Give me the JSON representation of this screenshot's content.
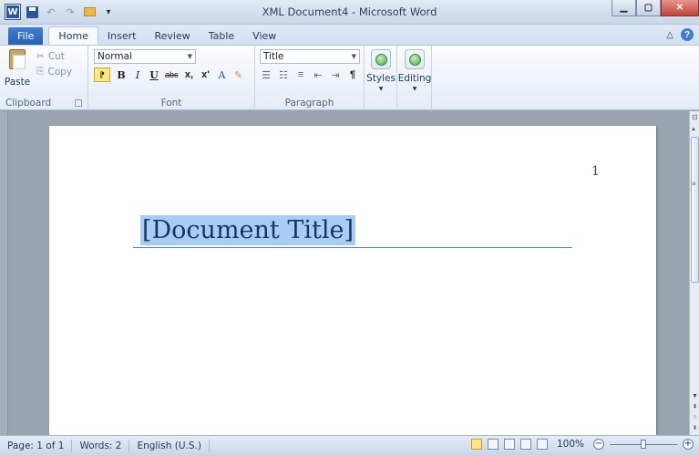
{
  "window": {
    "title": "XML Document4 - Microsoft Word",
    "logo_text": "W",
    "qat_extra": "▾"
  },
  "tabs": [
    {
      "label": "File"
    },
    {
      "label": "Home"
    },
    {
      "label": "Insert"
    },
    {
      "label": "Review"
    },
    {
      "label": "Table"
    },
    {
      "label": "View"
    }
  ],
  "ribbon": {
    "clipboard": {
      "paste_label": "Paste",
      "cut_label": "Cut",
      "copy_label": "Copy",
      "group_label": "Clipboard"
    },
    "font": {
      "style_value": "Normal",
      "bold": "B",
      "italic": "I",
      "underline": "U",
      "strikethrough": "abc",
      "subscript": "x,",
      "superscript": "x'",
      "font_color": "A",
      "group_label": "Font"
    },
    "paragraph": {
      "style_value": "Title",
      "pilcrow": "¶",
      "group_label": "Paragraph"
    },
    "styles_label": "Styles",
    "editing_label": "Editing"
  },
  "document": {
    "page_number": "1",
    "title": "[Document Title]"
  },
  "statusbar": {
    "page": "Page: 1 of 1",
    "words": "Words: 2",
    "language": "English (U.S.)",
    "zoom": "100%",
    "zoom_level": 1.0,
    "zoom_out": "−",
    "zoom_in": "+"
  },
  "colors": {
    "accent": "#2b579a",
    "selection": "#a8cdf2",
    "title_rule": "#4f81bd"
  }
}
